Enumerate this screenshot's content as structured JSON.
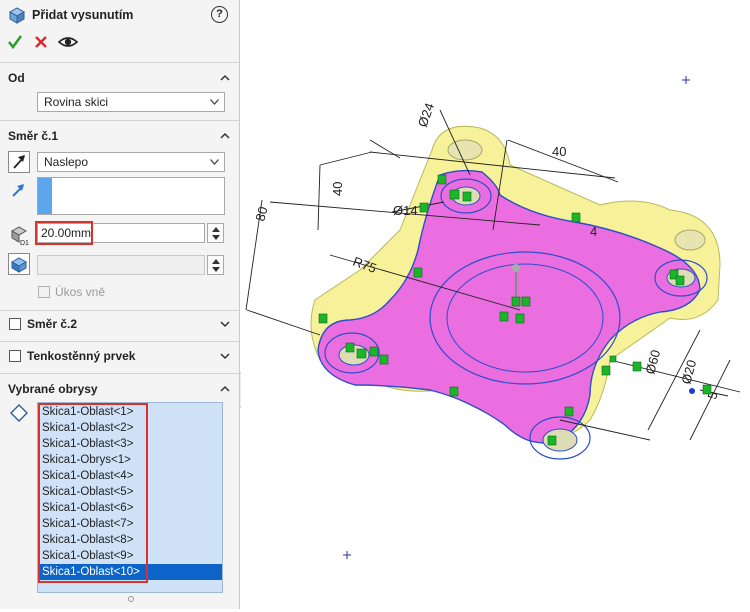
{
  "feature": {
    "title": "Přidat vysunutím",
    "help_label": "?",
    "icons": [
      "extrude-boss-icon",
      "ok-check-icon",
      "cancel-x-icon",
      "preview-eye-icon"
    ]
  },
  "from_section": {
    "title": "Od",
    "selected": "Rovina skici"
  },
  "direction1": {
    "title": "Směr č.1",
    "end_condition": "Naslepo",
    "depth_value": "20.00mm",
    "draft_outward_label": "Úkos vně"
  },
  "direction2": {
    "title": "Směr č.2"
  },
  "thin_feature": {
    "title": "Tenkostěnný prvek"
  },
  "selected_contours": {
    "title": "Vybrané obrysy",
    "items": [
      "Skica1-Oblast<1>",
      "Skica1-Oblast<2>",
      "Skica1-Oblast<3>",
      "Skica1-Obrys<1>",
      "Skica1-Oblast<4>",
      "Skica1-Oblast<5>",
      "Skica1-Oblast<6>",
      "Skica1-Oblast<7>",
      "Skica1-Oblast<8>",
      "Skica1-Oblast<9>",
      "Skica1-Oblast<10>"
    ],
    "selected_index": 10
  },
  "model_dimensions": {
    "d_top": "Ø24",
    "d_width": "40",
    "d_depth": "40",
    "d_hole": "Ø14",
    "d_80": "80",
    "d_r": "R75",
    "d_4": "4",
    "d_right1": "Ø60",
    "d_right2": "Ø20",
    "d_right3": "5"
  },
  "colors": {
    "accent_select": "#0c64c8",
    "face_magenta": "#ea6ee0",
    "face_yellow": "#f7f29a",
    "relation_green": "#1bb52a",
    "highlight_red": "#d9312b"
  }
}
